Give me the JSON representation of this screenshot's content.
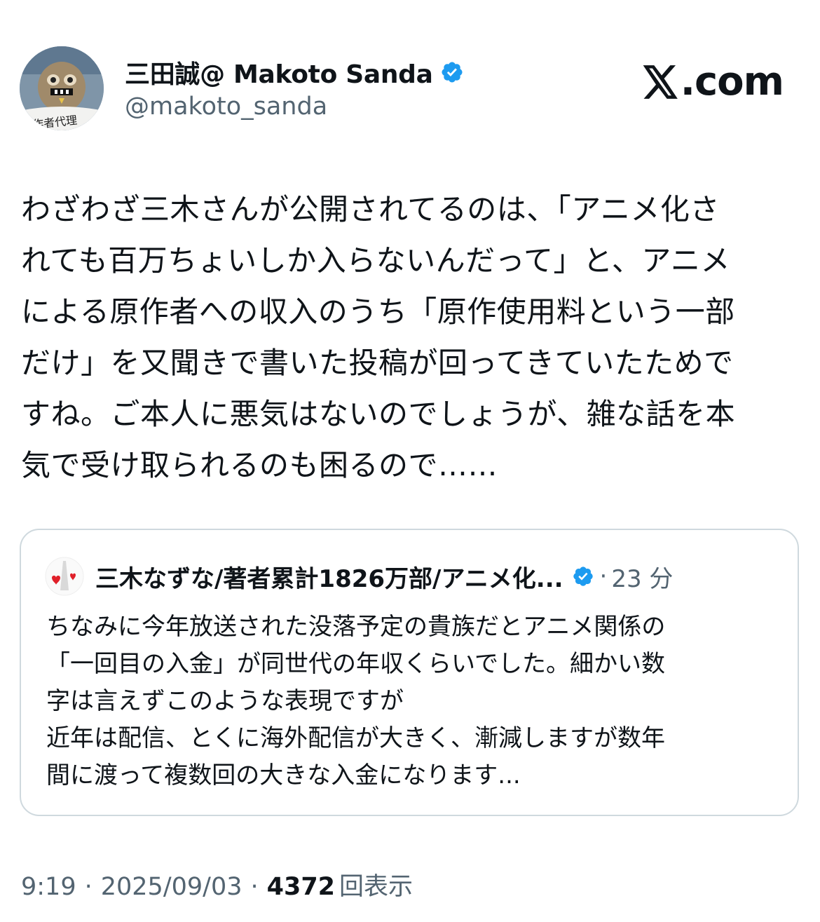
{
  "author": {
    "display_name": "三田誠@ Makoto Sanda",
    "handle": "@makoto_sanda",
    "avatar_caption": "作者代理"
  },
  "brand": {
    "logo_text": ".com"
  },
  "tweet": {
    "text": "わざわざ三木さんが公開されてるのは、「アニメ化さ\nれても百万ちょいしか入らないんだって」と、アニメ\nによる原作者への収入のうち「原作使用料という一部\nだけ」を又聞きで書いた投稿が回ってきていたためで\nすね。ご本人に悪気はないのでしょうが、雑な話を本\n気で受け取られるのも困るので……"
  },
  "quote": {
    "display_name": "三木なずな/著者累計1826万部/アニメ化...",
    "time": "23 分",
    "separator": "·",
    "text": "ちなみに今年放送された没落予定の貴族だとアニメ関係の\n「一回目の入金」が同世代の年収くらいでした。細かい数\n字は言えずこのような表現ですが\n近年は配信、とくに海外配信が大きく、漸減しますが数年\n間に渡って複数回の大きな入金になります..."
  },
  "footer": {
    "time": "9:19",
    "date": "2025/09/03",
    "views_count": "4372",
    "views_label": "回表示",
    "separator": "·"
  },
  "colors": {
    "verified": "#1d9bf0",
    "secondary_text": "#536471",
    "border": "#cfd9de"
  }
}
